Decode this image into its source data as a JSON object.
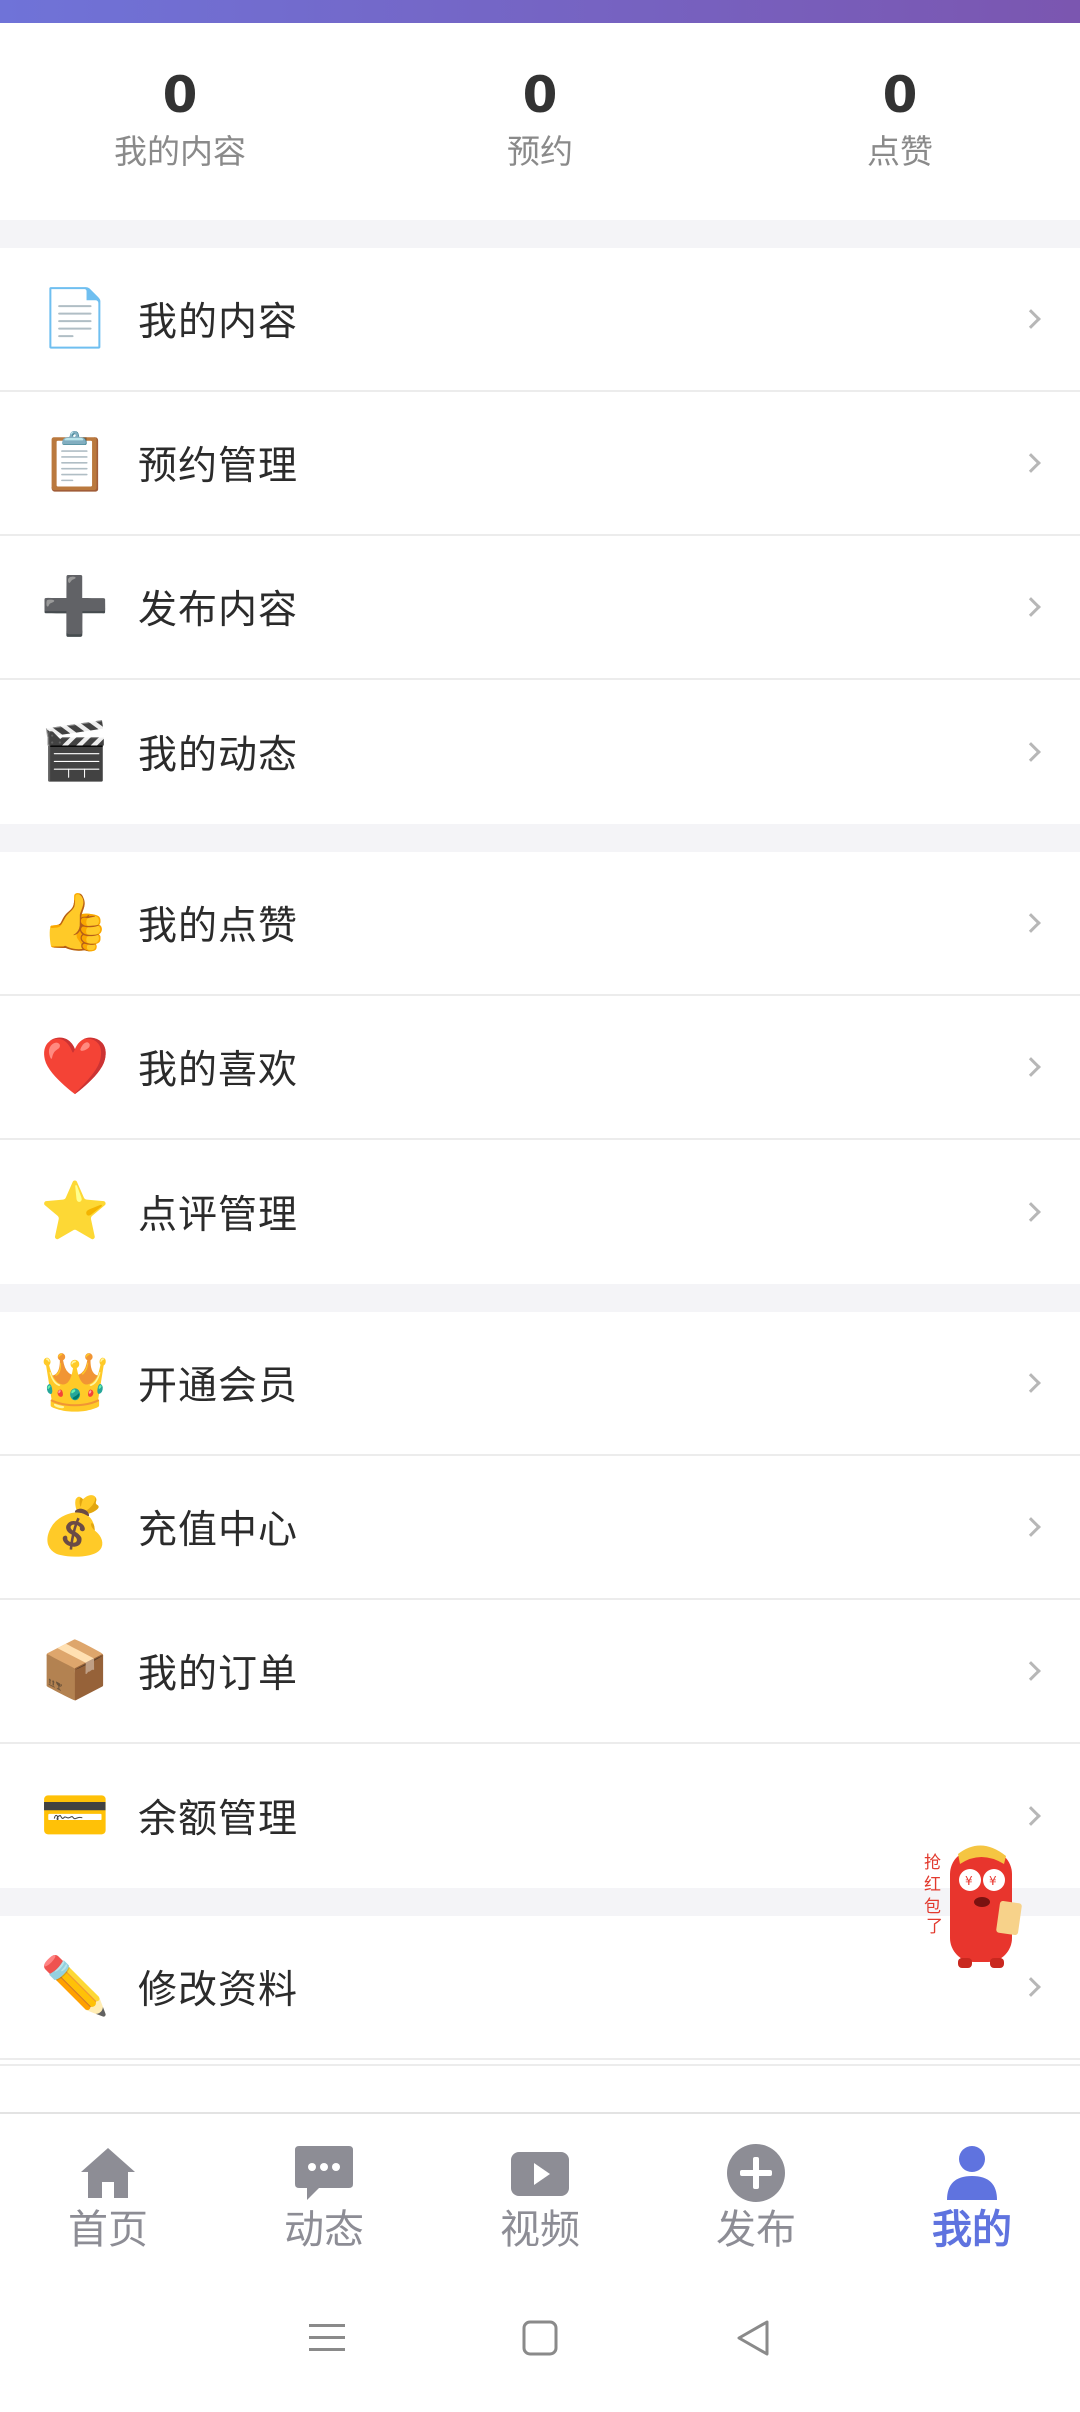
{
  "stats": [
    {
      "value": "0",
      "label": "我的内容"
    },
    {
      "value": "0",
      "label": "预约"
    },
    {
      "value": "0",
      "label": "点赞"
    }
  ],
  "menu": {
    "group1": [
      {
        "icon": "📄",
        "icon_name": "document-icon",
        "label": "我的内容"
      },
      {
        "icon": "📋",
        "icon_name": "clipboard-icon",
        "label": "预约管理"
      },
      {
        "icon": "➕",
        "icon_name": "plus-icon",
        "label": "发布内容"
      },
      {
        "icon": "🎬",
        "icon_name": "clapperboard-icon",
        "label": "我的动态"
      }
    ],
    "group2": [
      {
        "icon": "👍",
        "icon_name": "thumbs-up-icon",
        "label": "我的点赞"
      },
      {
        "icon": "❤️",
        "icon_name": "heart-icon",
        "label": "我的喜欢"
      },
      {
        "icon": "⭐",
        "icon_name": "star-icon",
        "label": "点评管理"
      }
    ],
    "group3": [
      {
        "icon": "👑",
        "icon_name": "crown-icon",
        "label": "开通会员"
      },
      {
        "icon": "💰",
        "icon_name": "money-bag-icon",
        "label": "充值中心"
      },
      {
        "icon": "📦",
        "icon_name": "package-icon",
        "label": "我的订单"
      },
      {
        "icon": "💳",
        "icon_name": "credit-card-icon",
        "label": "余额管理"
      }
    ],
    "group4": [
      {
        "icon": "✏️",
        "icon_name": "pencil-icon",
        "label": "修改资料"
      }
    ]
  },
  "tabs": [
    {
      "label": "首页",
      "icon_name": "home-icon",
      "active": false
    },
    {
      "label": "动态",
      "icon_name": "chat-bubble-icon",
      "active": false
    },
    {
      "label": "视频",
      "icon_name": "video-play-icon",
      "active": false
    },
    {
      "label": "发布",
      "icon_name": "add-circle-icon",
      "active": false
    },
    {
      "label": "我的",
      "icon_name": "user-icon",
      "active": true
    }
  ],
  "colors": {
    "accent": "#5f73df",
    "tab_inactive": "#8d8d95",
    "gap": "#f4f4f7",
    "header_gradient_start": "#6f73d8",
    "header_gradient_end": "#7b56b0"
  },
  "floating_badge": {
    "text": "抢红包了",
    "icon_name": "red-packet-mascot-icon"
  }
}
